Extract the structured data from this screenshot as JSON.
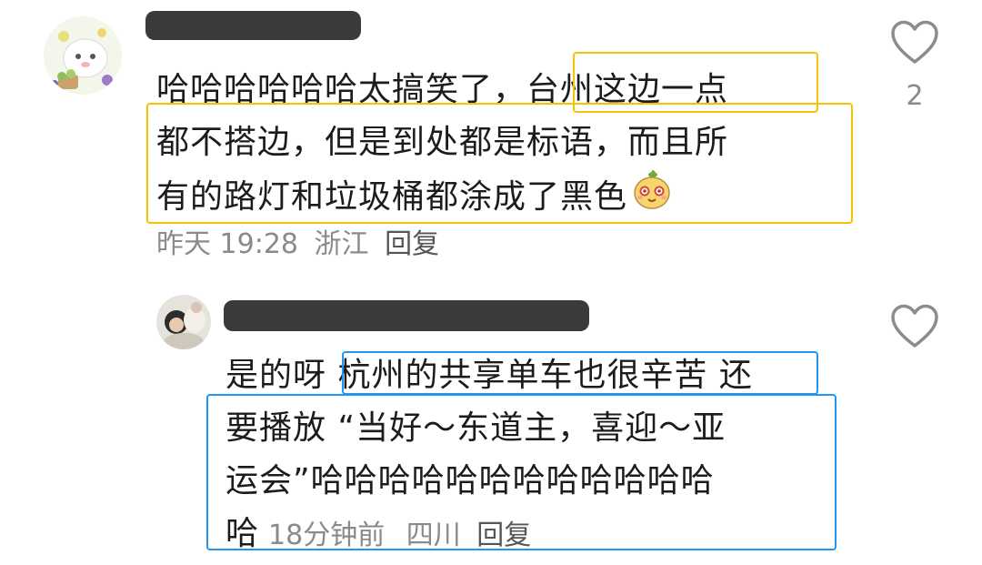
{
  "colors": {
    "highlight_top": "#f5c400",
    "highlight_bottom": "#2196f3",
    "meta_text": "#8a8a8a",
    "reply_text": "#555555"
  },
  "comments": [
    {
      "avatar_icon": "avatar-sheep-icon",
      "username_redacted": true,
      "text_lines": [
        "哈哈哈哈哈哈太搞笑了，台州这边一点",
        "都不搭边，但是到处都是标语，而且所",
        "有的路灯和垃圾桶都涂成了黑色"
      ],
      "emoji_icon": "mango-face-emoji-icon",
      "time": "昨天 19:28",
      "location": "浙江",
      "reply_label": "回复",
      "like_icon": "heart-outline-icon",
      "like_count": "2"
    },
    {
      "avatar_icon": "avatar-photo-icon",
      "username_redacted": true,
      "text_lines": [
        "是的呀 杭州的共享单车也很辛苦 还",
        "要播放 “当好～东道主，喜迎～亚",
        "运会”哈哈哈哈哈哈哈哈哈哈哈哈",
        "哈"
      ],
      "time": "18分钟前",
      "location": "四川",
      "reply_label": "回复",
      "like_icon": "heart-outline-icon",
      "like_count": ""
    }
  ]
}
